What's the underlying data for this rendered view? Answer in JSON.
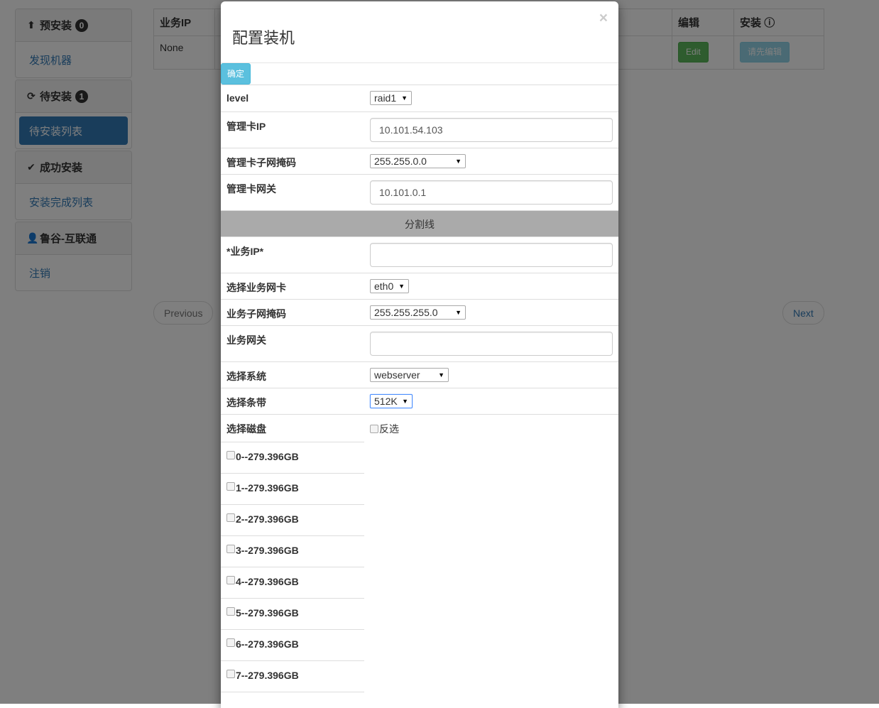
{
  "sidebar": {
    "sections": [
      {
        "title": "预安装",
        "badge": "0",
        "icon": "upload-circle-icon",
        "link": "发现机器"
      },
      {
        "title": "待安装",
        "badge": "1",
        "icon": "refresh-icon",
        "link": "待安装列表"
      },
      {
        "title": "成功安装",
        "icon": "check-icon",
        "link": "安装完成列表"
      },
      {
        "title": "鲁谷-互联通",
        "icon": "user-icon",
        "link": "注销"
      }
    ]
  },
  "table": {
    "headers": [
      "业务IP",
      "编辑",
      "安装"
    ],
    "row": {
      "ip": "None",
      "edit": "Edit",
      "install": "请先编辑"
    }
  },
  "pager": {
    "previous": "Previous",
    "next": "Next"
  },
  "modal": {
    "title": "配置装机",
    "close": "×",
    "confirm": "确定",
    "fields": {
      "level": {
        "label": "level",
        "value": "raid1"
      },
      "mgmt_ip": {
        "label": "管理卡IP",
        "value": "10.101.54.103"
      },
      "mgmt_mask": {
        "label": "管理卡子网掩码",
        "value": "255.255.0.0"
      },
      "mgmt_gw": {
        "label": "管理卡网关",
        "value": "10.101.0.1"
      },
      "divider": "分割线",
      "biz_ip": {
        "label": "*业务IP*",
        "value": ""
      },
      "biz_nic": {
        "label": "选择业务网卡",
        "value": "eth0"
      },
      "biz_mask": {
        "label": "业务子网掩码",
        "value": "255.255.255.0"
      },
      "biz_gw": {
        "label": "业务网关",
        "value": ""
      },
      "system": {
        "label": "选择系统",
        "value": "webserver"
      },
      "stripe": {
        "label": "选择条带",
        "value": "512K"
      },
      "disk": {
        "label": "选择磁盘",
        "invert": "反选"
      }
    },
    "disks": [
      "0--279.396GB",
      "1--279.396GB",
      "2--279.396GB",
      "3--279.396GB",
      "4--279.396GB",
      "5--279.396GB",
      "6--279.396GB",
      "7--279.396GB"
    ]
  }
}
